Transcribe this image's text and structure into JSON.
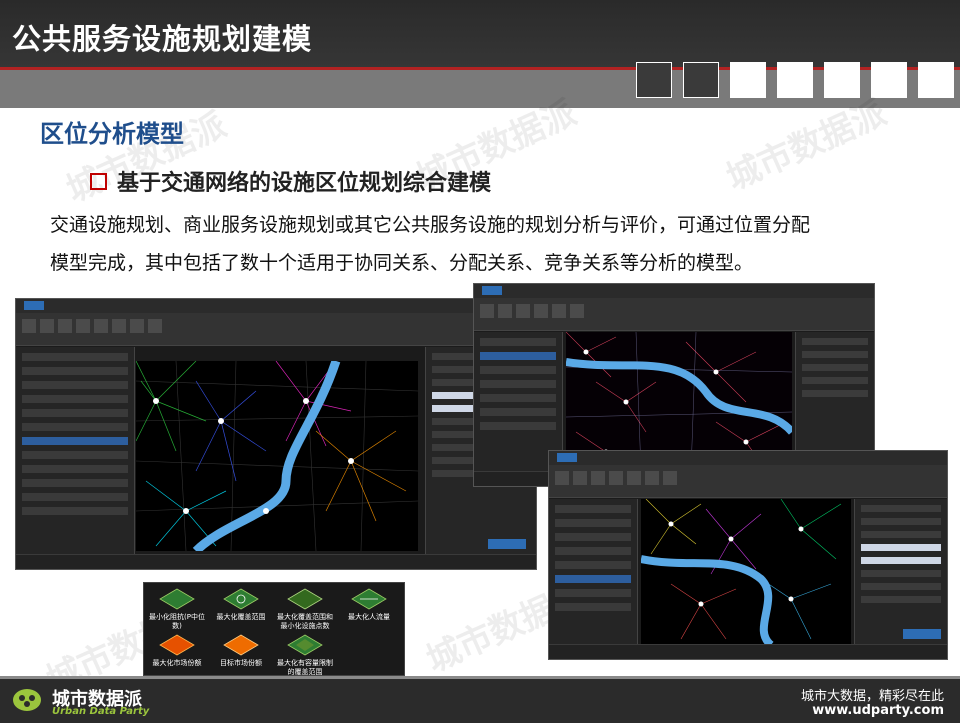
{
  "header": {
    "title": "公共服务设施规划建模"
  },
  "section": {
    "title": "区位分析模型"
  },
  "bullet": {
    "text": "基于交通网络的设施区位规划综合建模"
  },
  "paragraph": {
    "line1": "交通设施规划、商业服务设施规划或其它公共服务设施的规划分析与评价，可通过位置分配",
    "line2": "模型完成，其中包括了数十个适用于协同关系、分配关系、竞争关系等分析的模型。"
  },
  "watermark": {
    "text": "城市数据派",
    "url": "www.udparty.com"
  },
  "legend_panel": {
    "items": [
      "最小化阻抗(P中位数)",
      "最大化覆盖范围",
      "最大化覆盖范围和最小化设施点数",
      "最大化人流量",
      "最大化市场份额",
      "目标市场份额",
      "最大化有容量限制的覆盖范围"
    ]
  },
  "footer": {
    "brand_cn": "城市数据派",
    "brand_en": "Urban Data Party",
    "slogan": "城市大数据，精彩尽在此",
    "url": "www.udparty.com"
  },
  "colors": {
    "accent_blue": "#1f4e8c",
    "bullet_red": "#c00000",
    "brand_green": "#9bc53d",
    "river_blue": "#5aa9e6"
  }
}
